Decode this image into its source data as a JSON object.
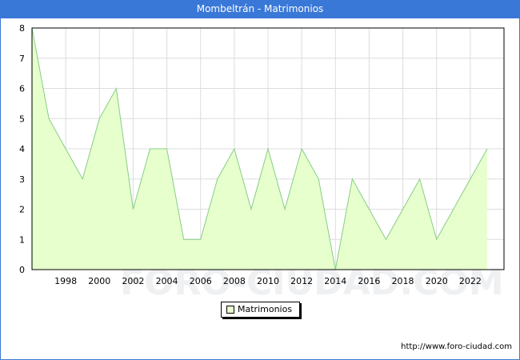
{
  "window": {
    "title": "Mombeltrán - Matrimonios"
  },
  "watermark": "FORO-CIUDAD.COM",
  "footer": {
    "source": "http://www.foro-ciudad.com"
  },
  "colors": {
    "title_bar": "#3a78d8",
    "area_fill": "#e6ffcc",
    "line": "#88cc88",
    "grid": "#dddddd"
  },
  "chart_data": {
    "type": "area",
    "title": "Mombeltrán - Matrimonios",
    "xlabel": "",
    "ylabel": "",
    "x": [
      1996,
      1997,
      1998,
      1999,
      2000,
      2001,
      2002,
      2003,
      2004,
      2005,
      2006,
      2007,
      2008,
      2009,
      2010,
      2011,
      2012,
      2013,
      2014,
      2015,
      2016,
      2017,
      2018,
      2019,
      2020,
      2021,
      2022,
      2023
    ],
    "series": [
      {
        "name": "Matrimonios",
        "values": [
          8,
          5,
          4,
          3,
          5,
          6,
          2,
          4,
          4,
          1,
          1,
          3,
          4,
          2,
          4,
          2,
          4,
          3,
          0,
          3,
          2,
          1,
          2,
          3,
          1,
          2,
          3,
          4
        ]
      }
    ],
    "xticks": [
      "1998",
      "2000",
      "2002",
      "2004",
      "2006",
      "2008",
      "2010",
      "2012",
      "2014",
      "2016",
      "2018",
      "2020",
      "2022"
    ],
    "yticks": [
      "0",
      "1",
      "2",
      "3",
      "4",
      "5",
      "6",
      "7",
      "8"
    ],
    "xlim": [
      1996,
      2024
    ],
    "ylim": [
      0,
      8
    ],
    "grid": true,
    "legend_position": "bottom-center"
  }
}
